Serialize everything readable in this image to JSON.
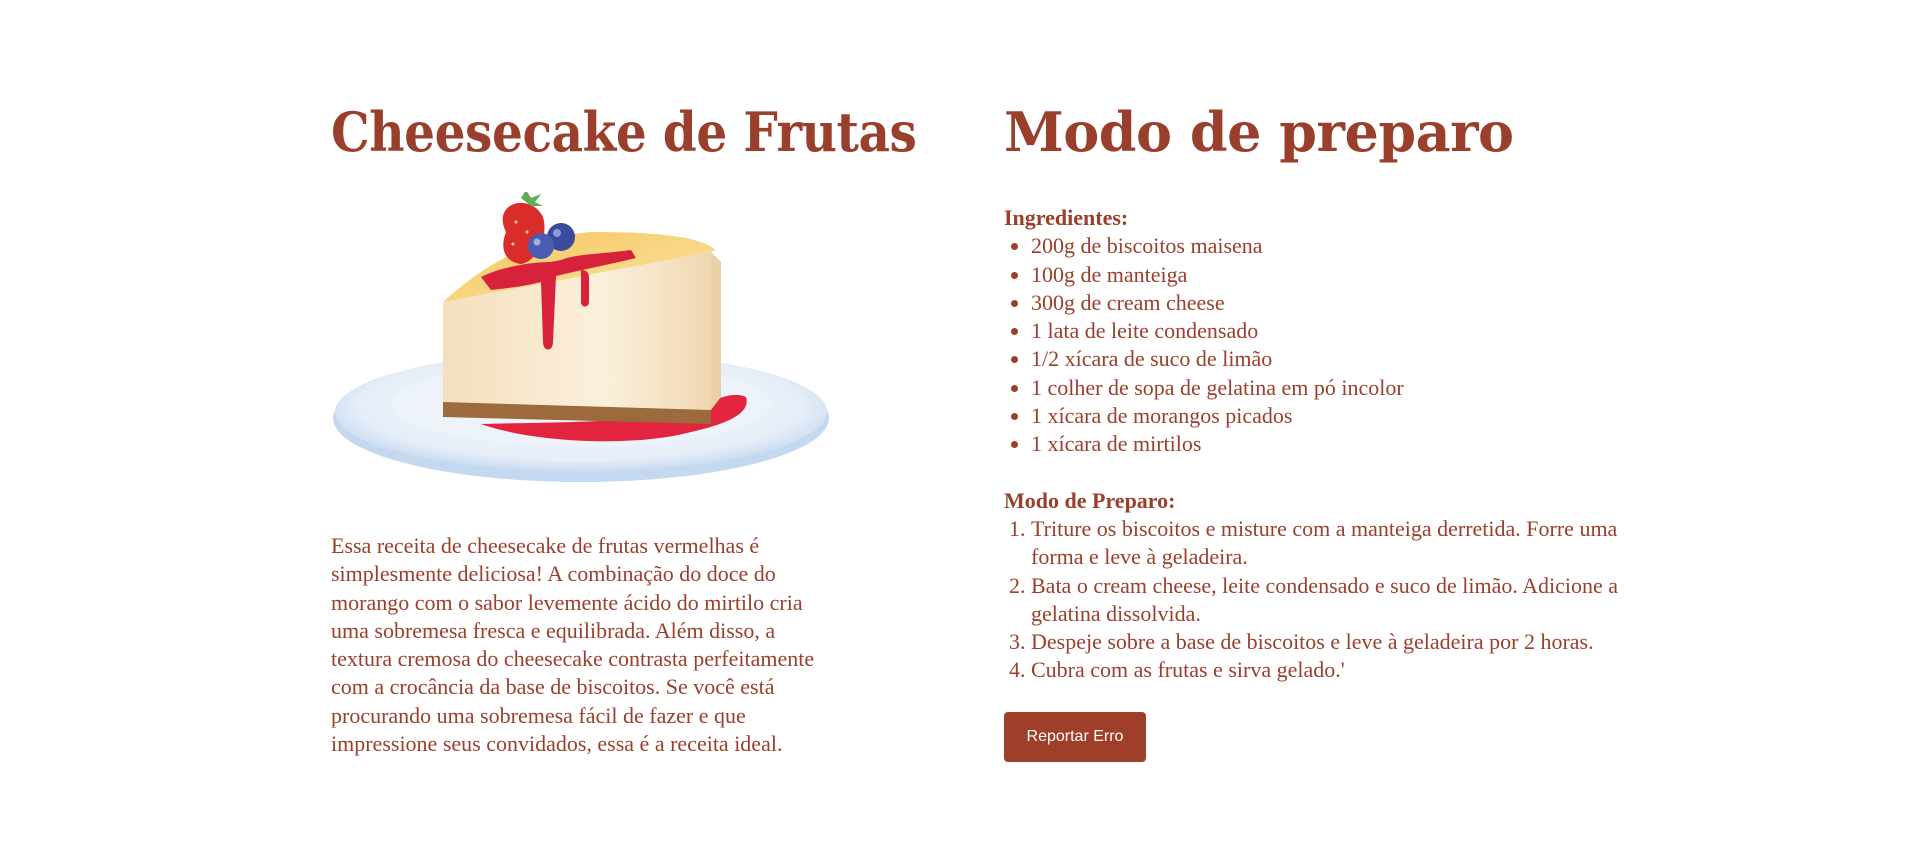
{
  "recipe": {
    "title": "Cheesecake de Frutas",
    "image_icon": "cheesecake-illustration",
    "description": "Essa receita de cheesecake de frutas vermelhas é simplesmente deliciosa! A combinação do doce do morango com o sabor levemente ácido do mirtilo cria uma sobremesa fresca e equilibrada. Além disso, a textura cremosa do cheesecake contrasta perfeitamente com a crocância da base de biscoitos. Se você está procurando uma sobremesa fácil de fazer e que impressione seus convidados, essa é a receita ideal."
  },
  "preparation": {
    "title": "Modo de preparo",
    "ingredients_title": "Ingredientes:",
    "ingredients": [
      "200g de biscoitos maisena",
      "100g de manteiga",
      "300g de cream cheese",
      "1 lata de leite condensado",
      "1/2 xícara de suco de limão",
      "1 colher de sopa de gelatina em pó incolor",
      "1 xícara de morangos picados",
      "1 xícara de mirtilos"
    ],
    "steps_title": "Modo de Preparo:",
    "steps": [
      "Triture os biscoitos e misture com a manteiga derretida. Forre uma forma e leve à geladeira.",
      "Bata o cream cheese, leite condensado e suco de limão. Adicione a gelatina dissolvida.",
      "Despeje sobre a base de biscoitos e leve à geladeira por 2 horas.",
      "Cubra com as frutas e sirva gelado.'"
    ],
    "report_button": "Reportar Erro"
  },
  "colors": {
    "accent": "#9a3f2c",
    "button": "#9f3f2a",
    "background": "#ffffff"
  }
}
